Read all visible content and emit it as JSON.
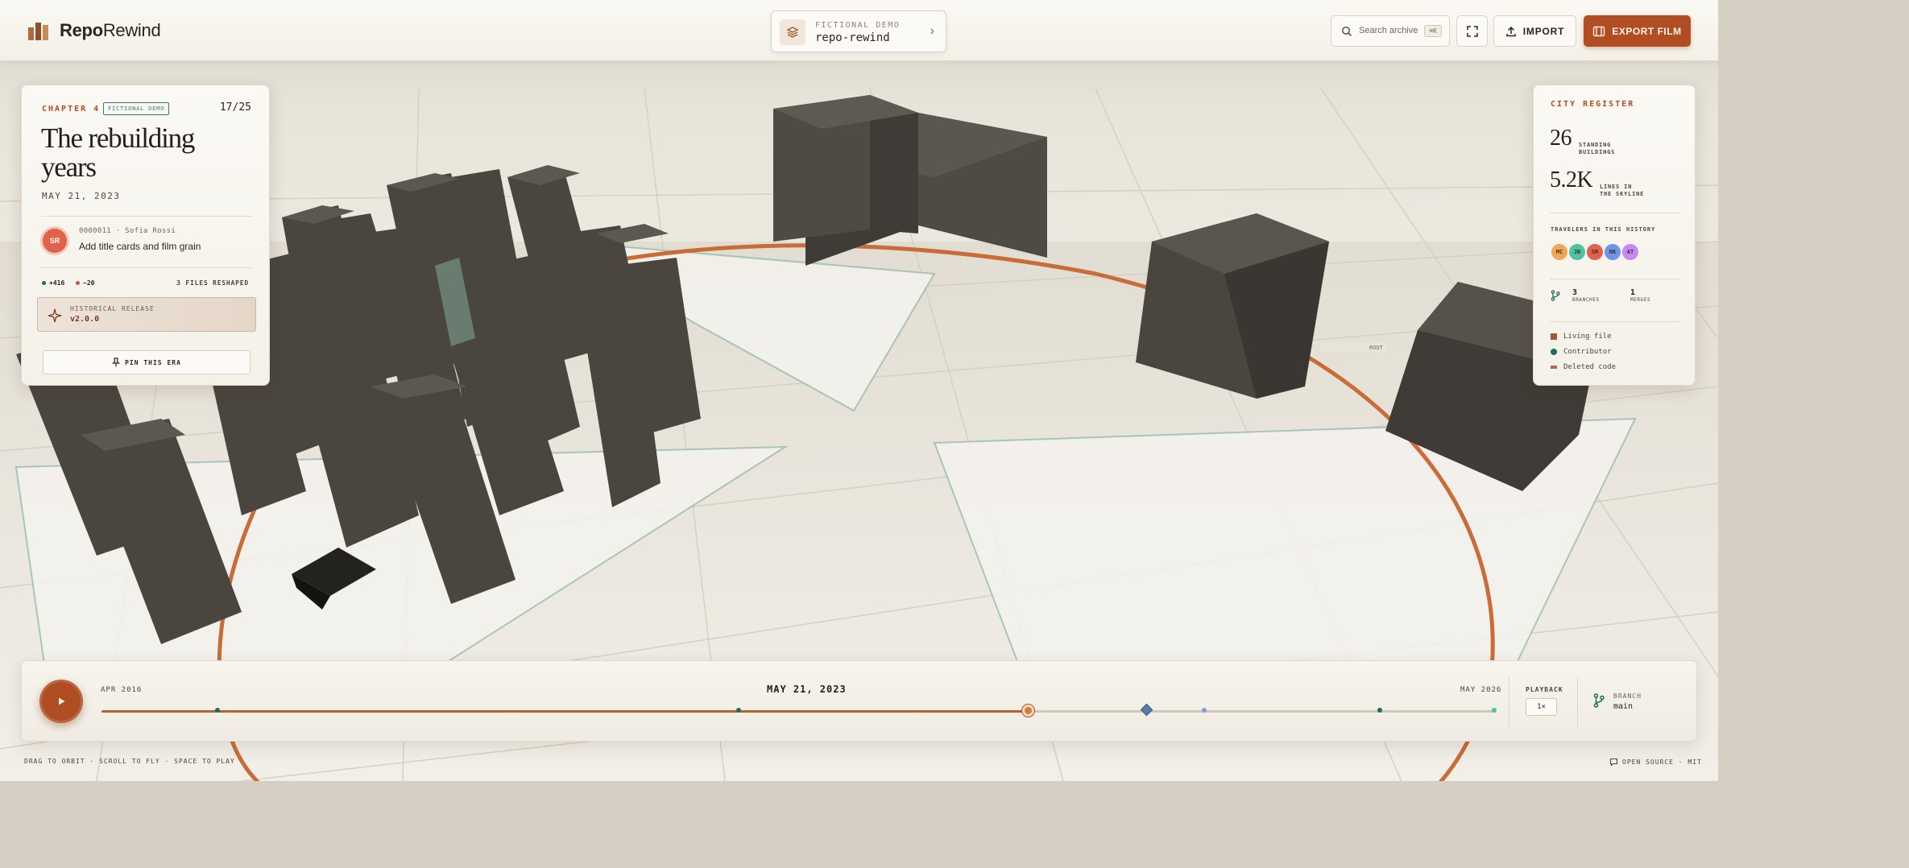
{
  "app": {
    "brand_strong": "Repo",
    "brand_light": "Rewind"
  },
  "repo": {
    "kicker": "FICTIONAL DEMO",
    "name": "repo-rewind",
    "chevron_icon": "chevron-right-icon"
  },
  "search": {
    "placeholder": "Search archive",
    "shortcut": "⌘K"
  },
  "toolbar": {
    "import_label": "IMPORT",
    "export_label": "EXPORT FILM",
    "accent": "#b14d23"
  },
  "chapter": {
    "kicker": "CHAPTER 4",
    "badge": "FICTIONAL DEMO",
    "counter": "17/25",
    "title": "The rebuilding years",
    "date": "MAY 21, 2023",
    "author_initials": "SR",
    "author_color": "#e2614a",
    "commit_meta": "0000011 · Sofia Rossi",
    "commit_message": "Add title cards and film grain",
    "additions": "+416",
    "deletions": "−20",
    "files": "3 FILES RESHAPED",
    "release_kicker": "HISTORICAL RELEASE",
    "release_version": "v2.0.0",
    "pin_label": "PIN THIS ERA"
  },
  "register": {
    "title": "CITY REGISTER",
    "buildings_value": "26",
    "buildings_label_1": "STANDING",
    "buildings_label_2": "BUILDINGS",
    "lines_value": "5.2K",
    "lines_label_1": "LINES IN",
    "lines_label_2": "THE SKYLINE",
    "travelers_title": "TRAVELERS IN THIS HISTORY",
    "travelers": [
      {
        "initials": "MC",
        "color": "#f0a857"
      },
      {
        "initials": "JB",
        "color": "#4cc4a4"
      },
      {
        "initials": "SR",
        "color": "#e2614a"
      },
      {
        "initials": "NK",
        "color": "#6e93e8"
      },
      {
        "initials": "AT",
        "color": "#c78af0"
      }
    ],
    "branches_value": "3",
    "branches_label": "BRANCHES",
    "merges_value": "1",
    "merges_label": "MERGES",
    "legend": [
      {
        "label": "Living file",
        "color": "#a0583a"
      },
      {
        "label": "Contributor",
        "color": "#1f6d5a"
      },
      {
        "label": "Deleted code",
        "color": "#b5674a"
      }
    ]
  },
  "timeline": {
    "start_label": "APR 2016",
    "current_label": "MAY 21, 2023",
    "end_label": "MAY 2026",
    "progress": 0.665,
    "marks": [
      {
        "pos": 0.083,
        "color": "#1f6d5a",
        "kind": "dot"
      },
      {
        "pos": 0.457,
        "color": "#1f6d5a",
        "kind": "dot"
      },
      {
        "pos": 0.75,
        "color": "#5a7aa8",
        "kind": "diamond"
      },
      {
        "pos": 0.791,
        "color": "#7e9be8",
        "kind": "dot"
      },
      {
        "pos": 0.917,
        "color": "#1f6d5a",
        "kind": "dot"
      },
      {
        "pos": 0.999,
        "color": "#4cc4a4",
        "kind": "dot"
      }
    ],
    "playback_label": "PLAYBACK",
    "playback_speed": "1×",
    "branch_label": "BRANCH",
    "branch_value": "main"
  },
  "footer": {
    "hints": "DRAG TO ORBIT · SCROLL TO FLY · SPACE TO PLAY",
    "license": "OPEN SOURCE · MIT"
  },
  "scene": {
    "sign_label": "ROOT"
  }
}
